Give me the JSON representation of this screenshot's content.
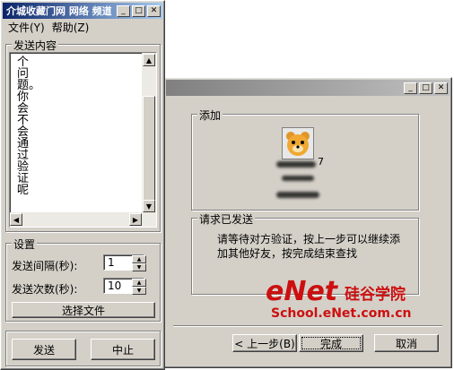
{
  "left_window": {
    "title": "介城收藏门网 网络 频道",
    "menu": [
      {
        "label": "文件(Y)"
      },
      {
        "label": "帮助(Z)"
      }
    ],
    "content_group": "发送内容",
    "message_text": "个问题。你会不会通过验证呢",
    "settings_group": "设置",
    "interval_label": "发送间隔(秒):",
    "interval_value": "1",
    "count_label": "发送次数(秒):",
    "count_value": "10",
    "select_file_button": "选择文件",
    "send_button": "发送",
    "stop_button": "中止"
  },
  "right_window": {
    "add_group": "添加",
    "contact_suffix": "7",
    "request_group": "请求已发送",
    "request_message_line1": "请等待对方验证，按上一步可以继续添",
    "request_message_line2": "加其他好友，按完成结束查找",
    "back_button": "< 上一步(B)",
    "finish_button": "完成",
    "cancel_button": "取消"
  },
  "watermark": {
    "brand": "eNet",
    "chinese": "硅谷学院",
    "url": "School.eNet.com.cn"
  },
  "colors": {
    "active_title": "#0a246a",
    "watermark_red": "#cc1010",
    "window_face": "#d4d0c8"
  }
}
